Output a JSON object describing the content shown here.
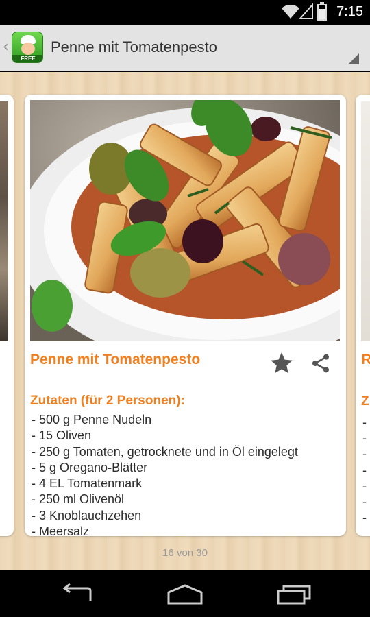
{
  "status_bar": {
    "time": "7:15"
  },
  "action_bar": {
    "title": "Penne mit Tomatenpesto",
    "app_icon_tag": "FREE"
  },
  "recipe": {
    "title": "Penne mit Tomatenpesto",
    "ingredients_header": "Zutaten (für 2 Personen):",
    "ingredients": [
      "500 g Penne Nudeln",
      "15 Oliven",
      "250 g Tomaten, getrocknete und in Öl eingelegt",
      "5 g Oregano-Blätter",
      "4 EL Tomatenmark",
      "250 ml Olivenöl",
      "3 Knoblauchzehen",
      "Meersalz"
    ]
  },
  "next_card_peek": {
    "title_initial": "R",
    "section_initial": "Z"
  },
  "pager": {
    "indicator": "16 von 30"
  },
  "colors": {
    "accent": "#f07f1f",
    "action_bar_bg": "#e3e3e3",
    "app_icon_green": "#3fae2a"
  },
  "icons": [
    "wifi-icon",
    "signal-icon",
    "battery-icon",
    "up-caret-icon",
    "star-icon",
    "share-icon",
    "back-icon",
    "home-icon",
    "recents-icon",
    "overflow-icon"
  ]
}
